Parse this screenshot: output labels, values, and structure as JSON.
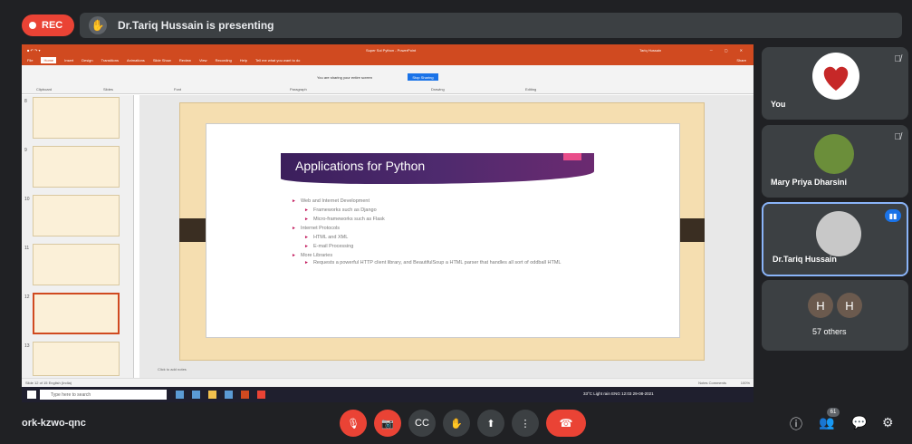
{
  "meet": {
    "rec_label": "REC",
    "presenting_text": "Dr.Tariq Hussain is presenting",
    "meeting_code": "ork-kzwo-qnc",
    "participant_count": "61"
  },
  "powerpoint": {
    "window_title": "Super Sol Python - PowerPoint",
    "user": "Tariq Hussain",
    "menu": [
      "File",
      "Home",
      "Insert",
      "Design",
      "Transitions",
      "Animations",
      "Slide Show",
      "Review",
      "View",
      "Recording",
      "Help",
      "Tell me what you want to do"
    ],
    "share_label": "Share",
    "sharing_notice": "You are sharing your entire screen",
    "stop_sharing": "Stop Sharing",
    "groups": [
      "Clipboard",
      "Slides",
      "Font",
      "Paragraph",
      "Drawing",
      "Editing"
    ],
    "slide_numbers": [
      "8",
      "9",
      "10",
      "11",
      "12",
      "13"
    ],
    "click_to_add_notes": "Click to add notes",
    "status_left": "Slide 12 of 15   English (India)",
    "status_right": "Notes   Comments",
    "zoom": "100%"
  },
  "slide": {
    "title": "Applications for Python",
    "bullets": [
      {
        "level": 1,
        "text": "Web and Internet Development"
      },
      {
        "level": 2,
        "text": "Frameworks such as Django"
      },
      {
        "level": 2,
        "text": "Micro-frameworks such as Flask"
      },
      {
        "level": 1,
        "text": "Internet Protocols"
      },
      {
        "level": 2,
        "text": "HTML and XML"
      },
      {
        "level": 2,
        "text": "E-mail Processing"
      },
      {
        "level": 1,
        "text": "More Libraries"
      },
      {
        "level": 2,
        "text": "Requests a powerful HTTP client library, and BeautifulSoup a HTML parser that handles all sort of oddball HTML"
      }
    ]
  },
  "taskbar": {
    "search_placeholder": "Type here to search",
    "tray_text": "33°C  Light rain   ENG  12:03  29-08-2021"
  },
  "participants": [
    {
      "name": "You",
      "muted": true
    },
    {
      "name": "Mary Priya Dharsini",
      "muted": true
    },
    {
      "name": "Dr.Tariq Hussain",
      "muted": false,
      "speaking": true
    },
    {
      "name": "57 others",
      "initials": [
        "H",
        "H"
      ]
    }
  ],
  "colors": {
    "rec_red": "#ea4335",
    "meet_bg": "#202124",
    "tile_bg": "#3c4043",
    "ppt_orange": "#d04a20",
    "slide_purple": "#4e2a6e"
  }
}
